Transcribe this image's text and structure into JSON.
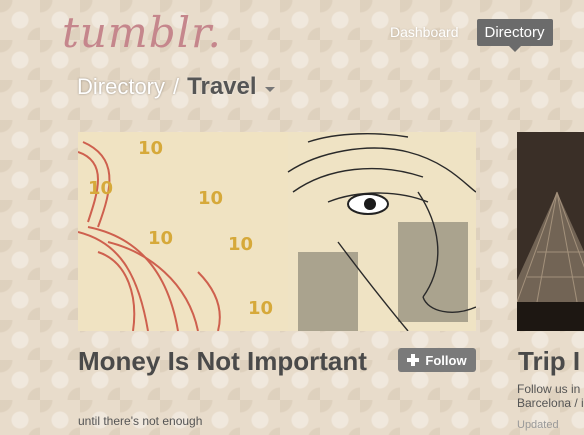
{
  "header": {
    "logo_text": "tumblr.",
    "nav": {
      "dashboard": "Dashboard",
      "directory": "Directory"
    }
  },
  "breadcrumb": {
    "root": "Directory",
    "separator": "/",
    "current": "Travel"
  },
  "cards": [
    {
      "title": "Money Is Not Important",
      "subtitle": "until there's not enough",
      "follow_label": "Follow",
      "image": "banknote-portrait"
    },
    {
      "title": "Trip I",
      "description_line1": "Follow us in",
      "description_line2": "Barcelona / i",
      "updated": "Updated"
    }
  ],
  "colors": {
    "logo": "#c5868c",
    "nav_active_bg": "#6b6b6b",
    "follow_bg": "#7a7a7a",
    "title": "#4a4a4a"
  }
}
